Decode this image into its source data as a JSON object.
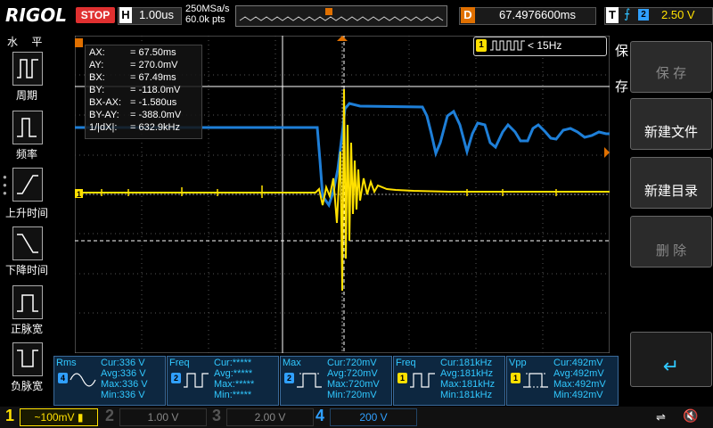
{
  "header": {
    "brand": "RIGOL",
    "run_state": "STOP",
    "timebase_label": "H",
    "timebase": "1.00us",
    "sample_rate": "250MSa/s",
    "memory_depth": "60.0k pts",
    "delay_label": "D",
    "delay": "67.4976600ms",
    "trigger_label": "T",
    "trigger_source": "2",
    "trigger_level": "2.50 V"
  },
  "left_menu": {
    "title": "水 平",
    "items": [
      {
        "label": "周期"
      },
      {
        "label": "频率"
      },
      {
        "label": "上升时间"
      },
      {
        "label": "下降时间"
      },
      {
        "label": "正脉宽"
      },
      {
        "label": "负脉宽"
      }
    ]
  },
  "cursor_info": {
    "rows": [
      {
        "name": "AX:",
        "value": "=   67.50ms"
      },
      {
        "name": "AY:",
        "value": "=   270.0mV"
      },
      {
        "name": "BX:",
        "value": "=   67.49ms"
      },
      {
        "name": "BY:",
        "value": "=   -118.0mV"
      },
      {
        "name": "BX-AX:",
        "value": "=   -1.580us"
      },
      {
        "name": "BY-AY:",
        "value": "=   -388.0mV"
      },
      {
        "name": "1/|dX|:",
        "value": "=   632.9kHz"
      }
    ]
  },
  "freq_counter": {
    "channel": "1",
    "text": "< 15Hz"
  },
  "right_menu": {
    "title_top": "保",
    "title_bottom": "存",
    "buttons": [
      {
        "label": "保 存",
        "enabled": false
      },
      {
        "label": "新建文件",
        "enabled": true
      },
      {
        "label": "新建目录",
        "enabled": true
      },
      {
        "label": "删 除",
        "enabled": false
      },
      {
        "label": "↵",
        "enabled": true
      }
    ]
  },
  "measurements": [
    {
      "name": "Rms",
      "channel": "4",
      "cur": "Cur:336 V",
      "avg": "Avg:336 V",
      "max": "Max:336 V",
      "min": "Min:336 V"
    },
    {
      "name": "Freq",
      "channel": "2",
      "cur": "Cur:*****",
      "avg": "Avg:*****",
      "max": "Max:*****",
      "min": "Min:*****"
    },
    {
      "name": "Max",
      "channel": "2",
      "cur": "Cur:720mV",
      "avg": "Avg:720mV",
      "max": "Max:720mV",
      "min": "Min:720mV"
    },
    {
      "name": "Freq",
      "channel": "1",
      "cur": "Cur:181kHz",
      "avg": "Avg:181kHz",
      "max": "Max:181kHz",
      "min": "Min:181kHz"
    },
    {
      "name": "Vpp",
      "channel": "1",
      "cur": "Cur:492mV",
      "avg": "Avg:492mV",
      "max": "Max:492mV",
      "min": "Min:492mV"
    }
  ],
  "channels": [
    {
      "num": "1",
      "scale": "100mV",
      "color": "#ffe000"
    },
    {
      "num": "2",
      "scale": "1.00 V",
      "color": "#555555"
    },
    {
      "num": "3",
      "scale": "2.00 V",
      "color": "#555555"
    },
    {
      "num": "4",
      "scale": "200 V",
      "color": "#30a0ff"
    }
  ],
  "colors": {
    "ch1": "#ffe000",
    "ch2": "#1e7fd8",
    "cursor": "#ffffff",
    "trigger_marker": "#e07000",
    "stop": "#e03030"
  }
}
